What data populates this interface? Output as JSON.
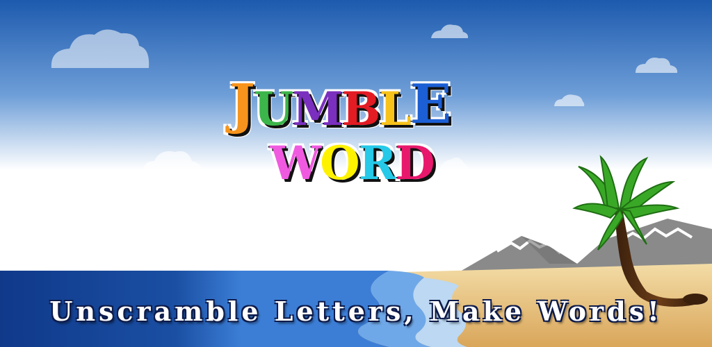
{
  "game": {
    "logo": {
      "line1": [
        {
          "char": "J",
          "color": "#f7941d",
          "size": "large"
        },
        {
          "char": "U",
          "color": "#3cb54a",
          "size": "small"
        },
        {
          "char": "M",
          "color": "#7b2fbe",
          "size": "small"
        },
        {
          "char": "B",
          "color": "#e31b23",
          "size": "small"
        },
        {
          "char": "L",
          "color": "#f7c21a",
          "size": "small"
        },
        {
          "char": "E",
          "color": "#1c5fd4",
          "size": "large"
        }
      ],
      "line2": [
        {
          "char": "W",
          "color": "#f05ae0",
          "size": "small"
        },
        {
          "char": "O",
          "color": "#fff200",
          "size": "small"
        },
        {
          "char": "R",
          "color": "#26c9e8",
          "size": "small"
        },
        {
          "char": "D",
          "color": "#e8186d",
          "size": "small"
        }
      ]
    },
    "tagline": "Unscramble Letters, Make Words!"
  },
  "colors": {
    "sky_top": "#1d5aae",
    "sky_bottom": "#ffffff",
    "sea": "#1a4fa3",
    "sand": "#e8c98a",
    "palm_leaf": "#3aa827",
    "mountain": "#8a8a8a"
  }
}
